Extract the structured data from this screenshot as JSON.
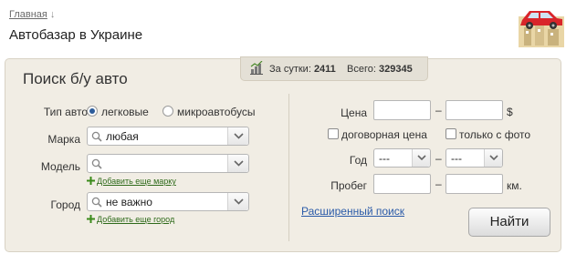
{
  "breadcrumb": {
    "home": "Главная",
    "arrow": "↓"
  },
  "title": "Автобазар в Украине",
  "panel": {
    "title": "Поиск б/у авто",
    "stats": {
      "day_label": "За сутки:",
      "day_value": "2411",
      "total_label": "Всего:",
      "total_value": "329345"
    }
  },
  "left": {
    "type_label": "Тип авто",
    "type_options": [
      "легковые",
      "микроавтобусы"
    ],
    "type_selected": "легковые",
    "brand_label": "Марка",
    "brand_value": "любая",
    "model_label": "Модель",
    "model_value": "",
    "add_brand": "Добавить еще марку",
    "city_label": "Город",
    "city_value": "не важно",
    "add_city": "Добавить еще город"
  },
  "right": {
    "price_label": "Цена",
    "price_from": "",
    "price_to": "",
    "price_unit": "$",
    "dash": "–",
    "negotiable": "договорная цена",
    "negotiable_checked": false,
    "photo_only": "только с фото",
    "photo_only_checked": false,
    "year_label": "Год",
    "year_from": "---",
    "year_to": "---",
    "mileage_label": "Пробег",
    "mileage_unit": "км.",
    "advanced": "Расширенный поиск",
    "submit": "Найти"
  },
  "icons": [
    "magnifier-icon",
    "chevron-down-icon",
    "plus-icon",
    "bar-chart-icon",
    "car-logo-icon"
  ],
  "colors": {
    "panel_bg": "#f1ede4",
    "link": "#2a5aa8",
    "add_link": "#2e6a1a",
    "radio_dot": "#2d5c9a"
  }
}
